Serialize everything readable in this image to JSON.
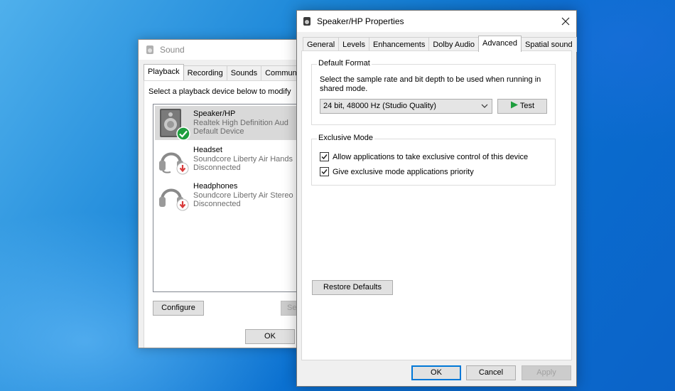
{
  "sound_dialog": {
    "title": "Sound",
    "tabs": [
      "Playback",
      "Recording",
      "Sounds",
      "Communica"
    ],
    "instruction": "Select a playback device below to modify",
    "devices": [
      {
        "name": "Speaker/HP",
        "driver": "Realtek High Definition Aud",
        "status": "Default Device"
      },
      {
        "name": "Headset",
        "driver": "Soundcore Liberty Air Hands",
        "status": "Disconnected"
      },
      {
        "name": "Headphones",
        "driver": "Soundcore Liberty Air Stereo",
        "status": "Disconnected"
      }
    ],
    "configure_label": "Configure",
    "set_default_label": "Se",
    "ok_label": "OK"
  },
  "properties_dialog": {
    "title": "Speaker/HP Properties",
    "tabs": [
      "General",
      "Levels",
      "Enhancements",
      "Dolby Audio",
      "Advanced",
      "Spatial sound"
    ],
    "active_tab": "Advanced",
    "default_format": {
      "legend": "Default Format",
      "description": "Select the sample rate and bit depth to be used when running in shared mode.",
      "selected_format": "24 bit, 48000 Hz (Studio Quality)",
      "test_label": "Test"
    },
    "exclusive_mode": {
      "legend": "Exclusive Mode",
      "options": [
        {
          "label": "Allow applications to take exclusive control of this device",
          "checked": true
        },
        {
          "label": "Give exclusive mode applications priority",
          "checked": true
        }
      ]
    },
    "restore_defaults_label": "Restore Defaults",
    "ok_label": "OK",
    "cancel_label": "Cancel",
    "apply_label": "Apply"
  },
  "colors": {
    "accent": "#0078d7",
    "status_ok": "#1e9e3e",
    "status_disconnected": "#d83b3b",
    "test_play": "#1e9e3e"
  }
}
